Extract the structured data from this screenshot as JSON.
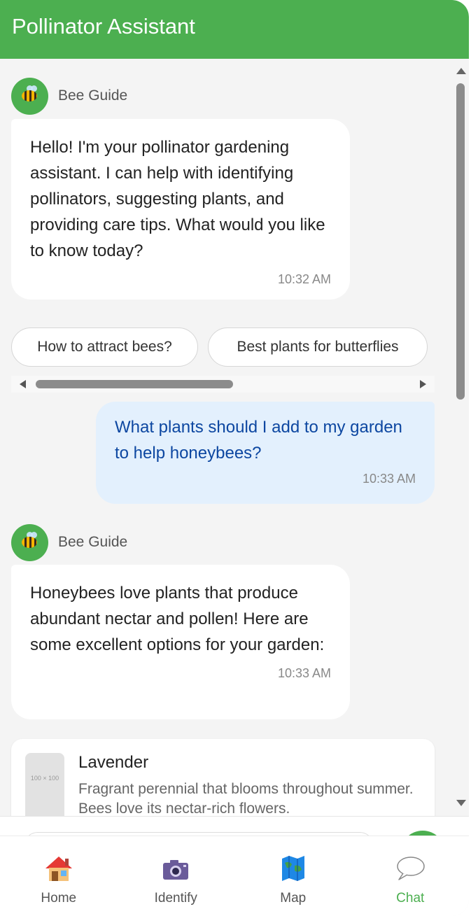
{
  "header": {
    "title": "Pollinator Assistant"
  },
  "messages": {
    "bot1": {
      "sender": "Bee Guide",
      "text": "Hello! I'm your pollinator gardening assistant. I can help with identifying pollinators, suggesting plants, and providing care tips. What would you like to know today?",
      "time": "10:32 AM"
    },
    "user1": {
      "text": "What plants should I add to my garden to help honeybees?",
      "time": "10:33 AM"
    },
    "bot2": {
      "sender": "Bee Guide",
      "text": "Honeybees love plants that produce abundant nectar and pollen! Here are some excellent options for your garden:",
      "time": "10:33 AM"
    }
  },
  "chips": [
    "How to attract bees?",
    "Best plants for butterflies"
  ],
  "plant_cards": [
    {
      "name": "Lavender",
      "description": "Fragrant perennial that blooms throughout summer. Bees love its nectar-rich flowers.",
      "placeholder": "100 × 100"
    }
  ],
  "nav": {
    "items": [
      {
        "label": "Home",
        "icon": "house-icon"
      },
      {
        "label": "Identify",
        "icon": "camera-icon"
      },
      {
        "label": "Map",
        "icon": "map-icon"
      },
      {
        "label": "Chat",
        "icon": "speech-bubble-icon"
      }
    ],
    "active": "Chat"
  },
  "colors": {
    "primary": "#4caf50",
    "user_bubble": "#e3f0fd",
    "user_text": "#0d47a1",
    "background": "#f4f4f4"
  }
}
